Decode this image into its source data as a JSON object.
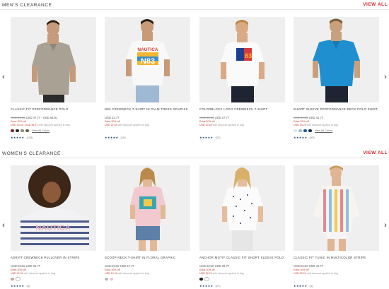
{
  "sections": [
    {
      "title": "MEN'S CLEARANCE",
      "view_all": "VIEW ALL",
      "products": [
        {
          "name": "CLASSIC FIT PERFORMANCE POLO",
          "price_old": "USD 69.50",
          "price_new": "USD 47.77 - USD 54.81",
          "promo1": "Extra 30% off",
          "promo2": "USD 33.44 - USD 38.37",
          "promo_note": "with discount applied in bag",
          "swatches": [
            "#7a2a2a",
            "#2b2b2b",
            "#8b8b80",
            "#6b5e4a"
          ],
          "view_all_colors": "View All Colors",
          "rating_count": "(118)"
        },
        {
          "name": "N83 CREWNECK T-SHIRT IN PALM TREES GRAPHIC",
          "price_old": "",
          "price_new": "USD 32.77",
          "promo1": "Extra 30% off",
          "promo2": "USD 22.94",
          "promo_note": "with discount applied in bag",
          "swatches": [],
          "view_all_colors": "",
          "rating_count": "(16)"
        },
        {
          "name": "COLORBLOCK LOGO CREWNECK T-SHIRT",
          "price_old": "USD 39.50",
          "price_new": "USD 27.77",
          "promo1": "Extra 30% off",
          "promo2": "USD 19.44",
          "promo_note": "with discount applied in bag",
          "swatches": [],
          "view_all_colors": "",
          "rating_count": "(22)"
        },
        {
          "name": "SHORT SLEEVE PERFORMANCE DECK POLO SHIRT",
          "price_old": "USD 59.50",
          "price_new": "USD 41.77",
          "promo1": "Extra 30% off",
          "promo2": "USD 29.24",
          "promo_note": "with discount applied in bag",
          "swatches": [
            "#e3e3e3",
            "#9bbfd6",
            "#1a5aa0",
            "#1d2a44"
          ],
          "view_all_colors": "View All Colors",
          "rating_count": "(93)"
        }
      ]
    },
    {
      "title": "WOMEN'S CLEARANCE",
      "view_all": "VIEW ALL",
      "products": [
        {
          "name": "ADRIFT CREWNECK PULLOVER IN STRIPE",
          "price_old": "USD 59.50",
          "price_new": "USD 31.77",
          "promo1": "Extra 30% off",
          "promo2": "USD 22.24",
          "promo_note": "with discount applied in bag",
          "swatches": [
            "#c9a6a6",
            "#ffffff"
          ],
          "view_all_colors": "",
          "rating_count": "(4)"
        },
        {
          "name": "SCOOP NECK T-SHIRT IN FLORAL GRAPHIC",
          "price_old": "USD 29.50",
          "price_new": "USD 17.77",
          "promo1": "Extra 30% off",
          "promo2": "USD 12.44",
          "promo_note": "with discount applied in bag",
          "swatches": [
            "#b9b9c4",
            "#e9c9cf"
          ],
          "view_all_colors": "",
          "rating_count": ""
        },
        {
          "name": "ANCHOR MOTIF CLASSIC FIT SHORT SLEEVE POLO",
          "price_old": "USD 49.50",
          "price_new": "USD 26.77",
          "promo1": "Extra 30% off",
          "promo2": "USD 18.74",
          "promo_note": "with discount applied in bag",
          "swatches": [
            "#222222",
            "#ffffff"
          ],
          "view_all_colors": "",
          "rating_count": "(27)"
        },
        {
          "name": "CLASSIC FIT TUNIC IN MULTICOLOR STRIPE",
          "price_old": "USD 69.50",
          "price_new": "USD 41.77",
          "promo1": "Extra 30% off",
          "promo2": "USD 29.24",
          "promo_note": "with discount applied in bag",
          "swatches": [],
          "view_all_colors": "",
          "rating_count": "(4)"
        }
      ]
    }
  ],
  "arrows": {
    "prev": "‹",
    "next": "›"
  },
  "stars": "★★★★★",
  "colors": {
    "accent_red": "#d2232a",
    "sale_red": "#c0392b",
    "rating_navy": "#1b3a6b"
  },
  "artwork": {
    "nautica_word": "NAUTICA",
    "number": "N83",
    "women_print": "NAUTICA"
  }
}
